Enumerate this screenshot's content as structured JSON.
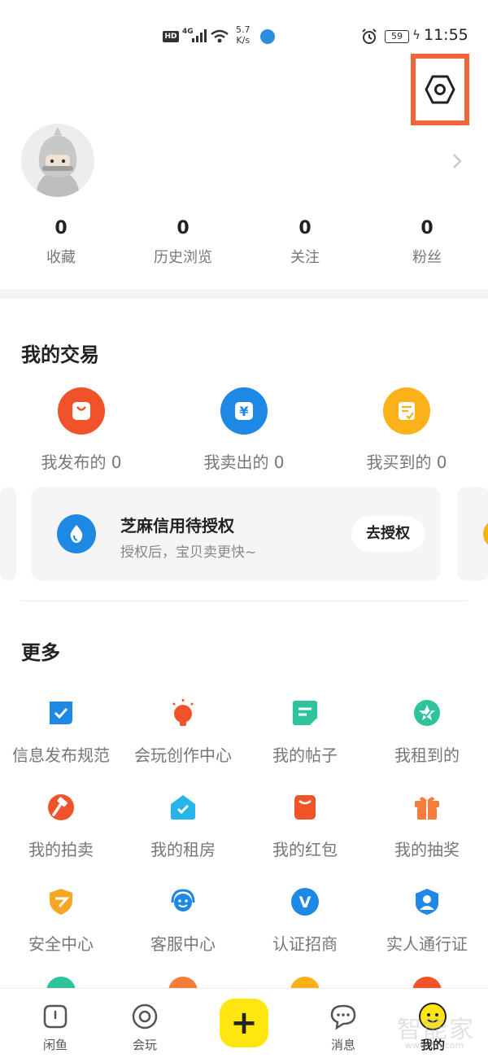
{
  "status_bar": {
    "hd": "HD",
    "network": "4G",
    "speed_value": "5.7",
    "speed_unit": "K/s",
    "battery": "59",
    "time": "11:55"
  },
  "profile": {
    "stats": [
      {
        "value": "0",
        "label": "收藏"
      },
      {
        "value": "0",
        "label": "历史浏览"
      },
      {
        "value": "0",
        "label": "关注"
      },
      {
        "value": "0",
        "label": "粉丝"
      }
    ]
  },
  "trade": {
    "title": "我的交易",
    "items": [
      {
        "label": "我发布的 0",
        "icon": "bag-icon",
        "color": "#f0532a"
      },
      {
        "label": "我卖出的 0",
        "icon": "yen-icon",
        "color": "#1e88e5"
      },
      {
        "label": "我买到的 0",
        "icon": "receipt-icon",
        "color": "#fbb21a"
      }
    ],
    "card": {
      "title": "芝麻信用待授权",
      "subtitle": "授权后，宝贝卖更快~",
      "button": "去授权"
    }
  },
  "more": {
    "title": "更多",
    "items": [
      {
        "label": "信息发布规范",
        "icon": "rule-check-icon",
        "color": "#1e88e5"
      },
      {
        "label": "会玩创作中心",
        "icon": "bulb-icon",
        "color": "#f0532a"
      },
      {
        "label": "我的帖子",
        "icon": "post-icon",
        "color": "#2ec39b"
      },
      {
        "label": "我租到的",
        "icon": "rent-badge-icon",
        "color": "#2ec39b"
      },
      {
        "label": "我的拍卖",
        "icon": "auction-hammer-icon",
        "color": "#f0532a"
      },
      {
        "label": "我的租房",
        "icon": "house-icon",
        "color": "#26b5e8"
      },
      {
        "label": "我的红包",
        "icon": "red-envelope-icon",
        "color": "#f0532a"
      },
      {
        "label": "我的抽奖",
        "icon": "gift-icon",
        "color": "#f57c3a"
      },
      {
        "label": "安全中心",
        "icon": "shield-icon",
        "color": "#f5a623"
      },
      {
        "label": "客服中心",
        "icon": "headset-icon",
        "color": "#1e88e5"
      },
      {
        "label": "认证招商",
        "icon": "verified-v-icon",
        "color": "#1e88e5"
      },
      {
        "label": "实人通行证",
        "icon": "person-id-icon",
        "color": "#1e88e5"
      }
    ]
  },
  "tabbar": {
    "items": [
      {
        "label": "闲鱼"
      },
      {
        "label": "会玩"
      },
      {
        "label": "消息"
      },
      {
        "label": "我的"
      }
    ]
  },
  "watermark": {
    "text": "智能家",
    "sub": "www.znj.com"
  },
  "colors": {
    "accent_yellow": "#ffe60f",
    "highlight_box": "#f0663a"
  }
}
